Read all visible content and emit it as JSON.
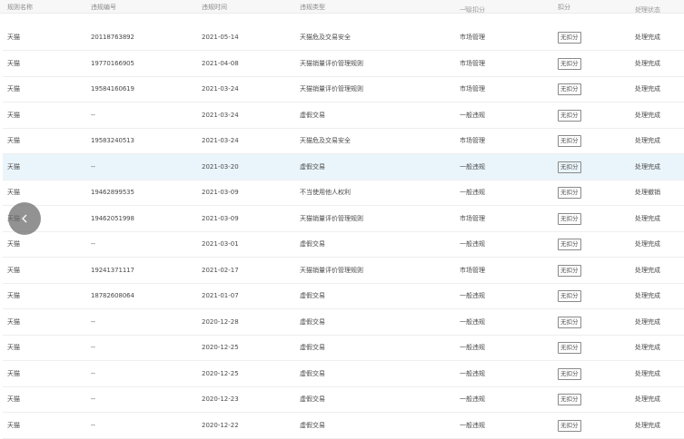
{
  "header": {
    "cols": [
      "规则名称",
      "违规编号",
      "违规时间",
      "违规类型",
      "一级扣分",
      "扣分",
      "处理状态"
    ]
  },
  "rows": [
    {
      "platform": "天猫",
      "id": "20118763892",
      "date": "2021-05-14",
      "type": "天猫危及交易安全",
      "category": "市场管理",
      "deduct": "无扣分",
      "status": "处理完成"
    },
    {
      "platform": "天猫",
      "id": "19770166905",
      "date": "2021-04-08",
      "type": "天猫销量评价管理规则",
      "category": "市场管理",
      "deduct": "无扣分",
      "status": "处理完成"
    },
    {
      "platform": "天猫",
      "id": "19584160619",
      "date": "2021-03-24",
      "type": "天猫销量评价管理规则",
      "category": "市场管理",
      "deduct": "无扣分",
      "status": "处理完成"
    },
    {
      "platform": "天猫",
      "id": "--",
      "date": "2021-03-24",
      "type": "虚假交易",
      "category": "一般违规",
      "deduct": "无扣分",
      "status": "处理完成"
    },
    {
      "platform": "天猫",
      "id": "19583240513",
      "date": "2021-03-24",
      "type": "天猫危及交易安全",
      "category": "市场管理",
      "deduct": "无扣分",
      "status": "处理完成"
    },
    {
      "platform": "天猫",
      "id": "--",
      "date": "2021-03-20",
      "type": "虚假交易",
      "category": "一般违规",
      "deduct": "无扣分",
      "status": "处理完成"
    },
    {
      "platform": "天猫",
      "id": "19462899535",
      "date": "2021-03-09",
      "type": "不当使用他人权利",
      "category": "一般违规",
      "deduct": "无扣分",
      "status": "处理撤销"
    },
    {
      "platform": "天猫",
      "id": "19462051998",
      "date": "2021-03-09",
      "type": "天猫销量评价管理规则",
      "category": "市场管理",
      "deduct": "无扣分",
      "status": "处理完成"
    },
    {
      "platform": "天猫",
      "id": "--",
      "date": "2021-03-01",
      "type": "虚假交易",
      "category": "一般违规",
      "deduct": "无扣分",
      "status": "处理完成"
    },
    {
      "platform": "天猫",
      "id": "19241371117",
      "date": "2021-02-17",
      "type": "天猫销量评价管理规则",
      "category": "市场管理",
      "deduct": "无扣分",
      "status": "处理完成"
    },
    {
      "platform": "天猫",
      "id": "18782608064",
      "date": "2021-01-07",
      "type": "虚假交易",
      "category": "一般违规",
      "deduct": "无扣分",
      "status": "处理完成"
    },
    {
      "platform": "天猫",
      "id": "--",
      "date": "2020-12-28",
      "type": "虚假交易",
      "category": "一般违规",
      "deduct": "无扣分",
      "status": "处理完成"
    },
    {
      "platform": "天猫",
      "id": "--",
      "date": "2020-12-25",
      "type": "虚假交易",
      "category": "一般违规",
      "deduct": "无扣分",
      "status": "处理完成"
    },
    {
      "platform": "天猫",
      "id": "--",
      "date": "2020-12-25",
      "type": "虚假交易",
      "category": "一般违规",
      "deduct": "无扣分",
      "status": "处理完成"
    },
    {
      "platform": "天猫",
      "id": "--",
      "date": "2020-12-23",
      "type": "虚假交易",
      "category": "一般违规",
      "deduct": "无扣分",
      "status": "处理完成"
    },
    {
      "platform": "天猫",
      "id": "--",
      "date": "2020-12-22",
      "type": "虚假交易",
      "category": "一般违规",
      "deduct": "无扣分",
      "status": "处理完成"
    }
  ],
  "selected_row_index": 5,
  "back_button": {
    "icon": "chevron-left-icon"
  },
  "colors": {
    "selected_row_bg": "#eaf5fb",
    "back_button_bg": "#6e6e6e"
  }
}
